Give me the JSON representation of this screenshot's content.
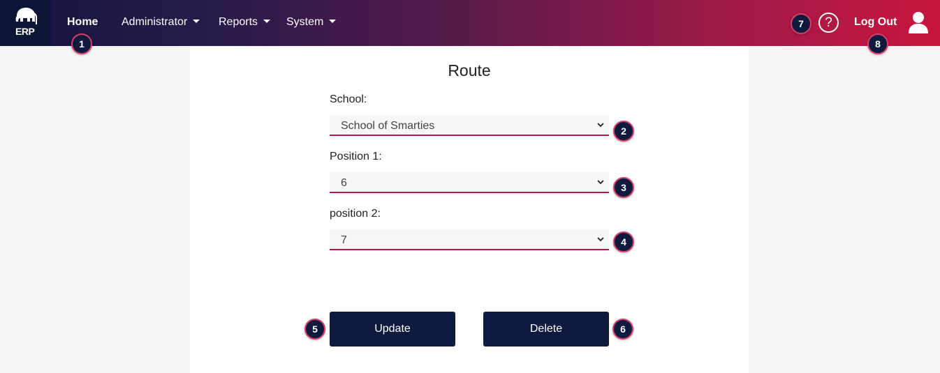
{
  "nav": {
    "logo_text": "ERP",
    "home": "Home",
    "administrator": "Administrator",
    "reports": "Reports",
    "system": "System",
    "help_glyph": "?",
    "logout": "Log Out"
  },
  "page": {
    "title": "Route"
  },
  "form": {
    "school_label": "School:",
    "school_value": "School of Smarties",
    "position1_label": "Position 1:",
    "position1_value": "6",
    "position2_label": "position 2:",
    "position2_value": "7",
    "update_label": "Update",
    "delete_label": "Delete"
  },
  "markers": [
    "1",
    "2",
    "3",
    "4",
    "5",
    "6",
    "7",
    "8"
  ],
  "colors": {
    "nav_start": "#13163f",
    "nav_end": "#c8163f",
    "button": "#0f1a3e",
    "accent": "#b8154a"
  },
  "icons": {
    "logo": "elephant-logo-icon",
    "help": "question-circle-icon",
    "user": "user-icon",
    "dropdown": "chevron-down-icon"
  }
}
